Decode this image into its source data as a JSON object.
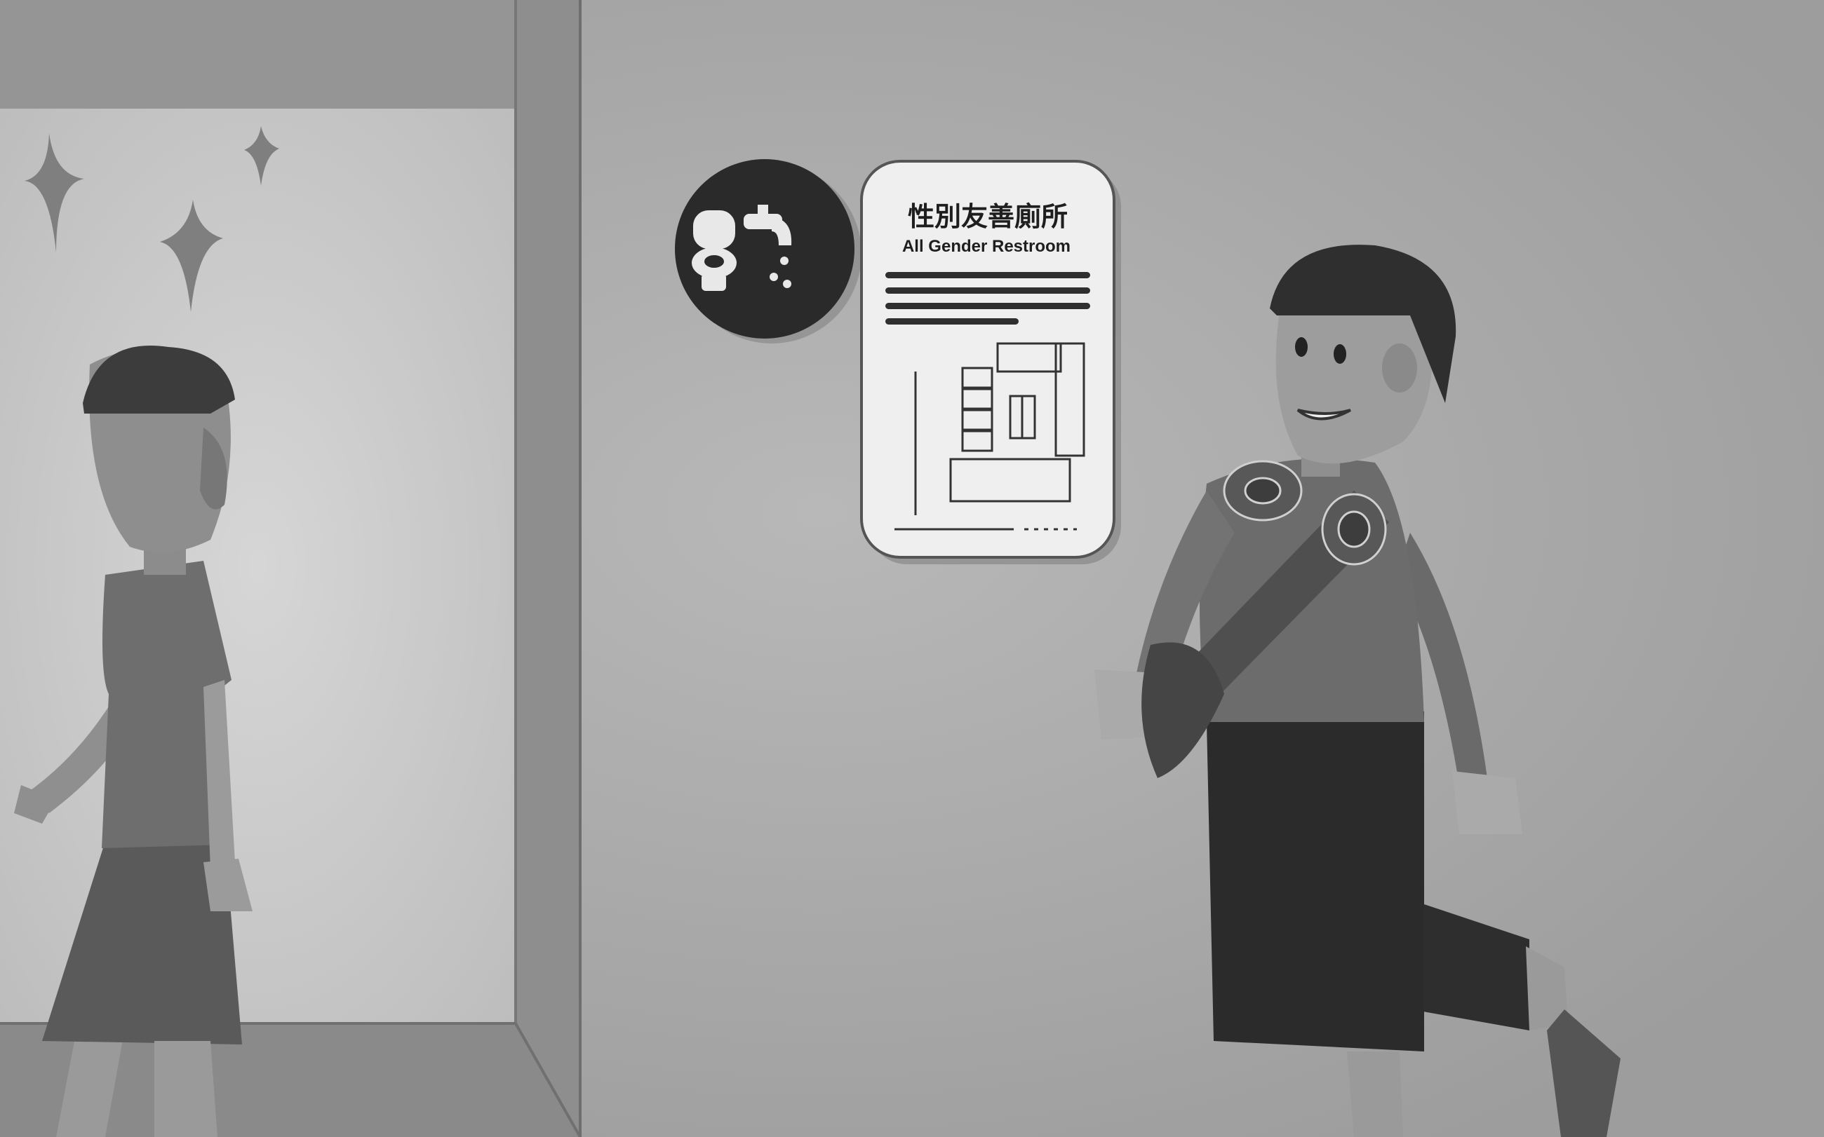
{
  "scene": {
    "background": "#a8a8a8",
    "wall_color": "#aaaaaa",
    "doorway_color": "#c9c9c9",
    "frame_color": "#8e8e8e"
  },
  "sign": {
    "title_zh": "性別友善廁所",
    "title_en": "All Gender Restroom"
  },
  "icon_badge": {
    "icons": [
      "toilet-icon",
      "faucet-icon"
    ]
  },
  "people": {
    "left_person": "walking-child",
    "right_person": "smiling-child-with-headphones-and-bag"
  }
}
